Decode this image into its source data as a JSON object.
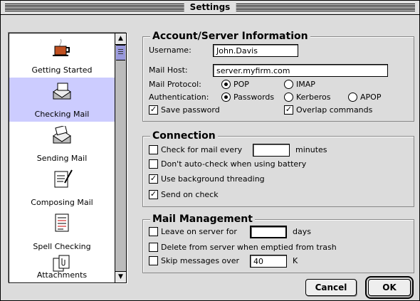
{
  "window": {
    "title": "Settings"
  },
  "sidebar": {
    "items": [
      {
        "label": "Getting Started",
        "icon": "coffee-cup-icon"
      },
      {
        "label": "Checking Mail",
        "icon": "checking-mail-icon"
      },
      {
        "label": "Sending Mail",
        "icon": "sending-mail-icon"
      },
      {
        "label": "Composing Mail",
        "icon": "composing-mail-icon"
      },
      {
        "label": "Spell Checking",
        "icon": "spell-check-icon"
      },
      {
        "label": "Attachments",
        "icon": "attachments-icon"
      }
    ],
    "selected_index": 1
  },
  "account": {
    "title": "Account/Server Information",
    "username_label": "Username:",
    "username_value": "John.Davis",
    "mailhost_label": "Mail Host:",
    "mailhost_value": "server.myfirm.com",
    "protocol_label": "Mail Protocol:",
    "protocol_pop": "POP",
    "protocol_imap": "IMAP",
    "auth_label": "Authentication:",
    "auth_passwords": "Passwords",
    "auth_kerberos": "Kerberos",
    "auth_apop": "APOP",
    "save_password": "Save password",
    "overlap_commands": "Overlap commands"
  },
  "connection": {
    "title": "Connection",
    "check_every": "Check for mail every",
    "minutes": "minutes",
    "check_every_value": "",
    "dont_autocheck": "Don't auto-check when using battery",
    "background_threading": "Use background threading",
    "send_on_check": "Send on check"
  },
  "management": {
    "title": "Mail Management",
    "leave_on_server": "Leave on server for",
    "days": "days",
    "leave_value": "",
    "delete_from_server": "Delete from server when emptied from trash",
    "skip_messages": "Skip messages over",
    "skip_value": "40",
    "skip_unit": "K"
  },
  "buttons": {
    "cancel": "Cancel",
    "ok": "OK"
  },
  "colors": {
    "selection": "#ccccff",
    "window_bg": "#dcdcdc"
  }
}
